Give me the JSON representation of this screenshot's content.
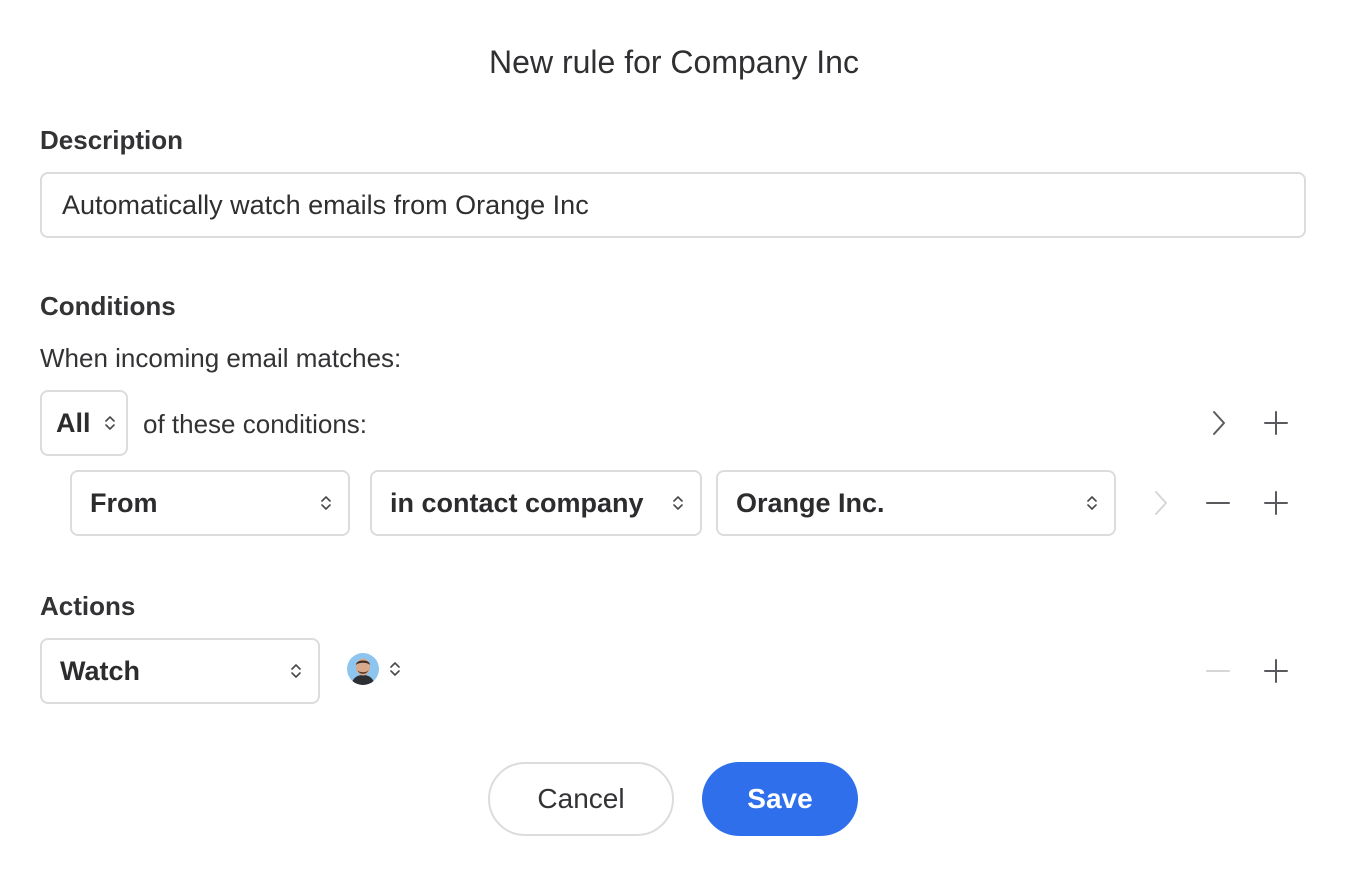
{
  "dialog": {
    "title": "New rule for Company Inc"
  },
  "description": {
    "label": "Description",
    "value": "Automatically watch emails from Orange Inc"
  },
  "conditions": {
    "label": "Conditions",
    "intro": "When incoming email matches:",
    "match_mode": "All",
    "match_suffix": "of these conditions:",
    "rows": [
      {
        "field": "From",
        "operator": "in contact company",
        "value": "Orange Inc."
      }
    ]
  },
  "actions": {
    "label": "Actions",
    "rows": [
      {
        "action": "Watch",
        "assignee_icon": "user-avatar"
      }
    ]
  },
  "footer": {
    "cancel_label": "Cancel",
    "save_label": "Save"
  },
  "colors": {
    "accent": "#2f6fec",
    "border": "#dcdcde",
    "disabled_icon": "#d6d6d8",
    "icon": "#5a5a5e"
  },
  "icons": [
    "chevron-updown-icon",
    "chevron-right-icon",
    "plus-icon",
    "minus-icon"
  ]
}
